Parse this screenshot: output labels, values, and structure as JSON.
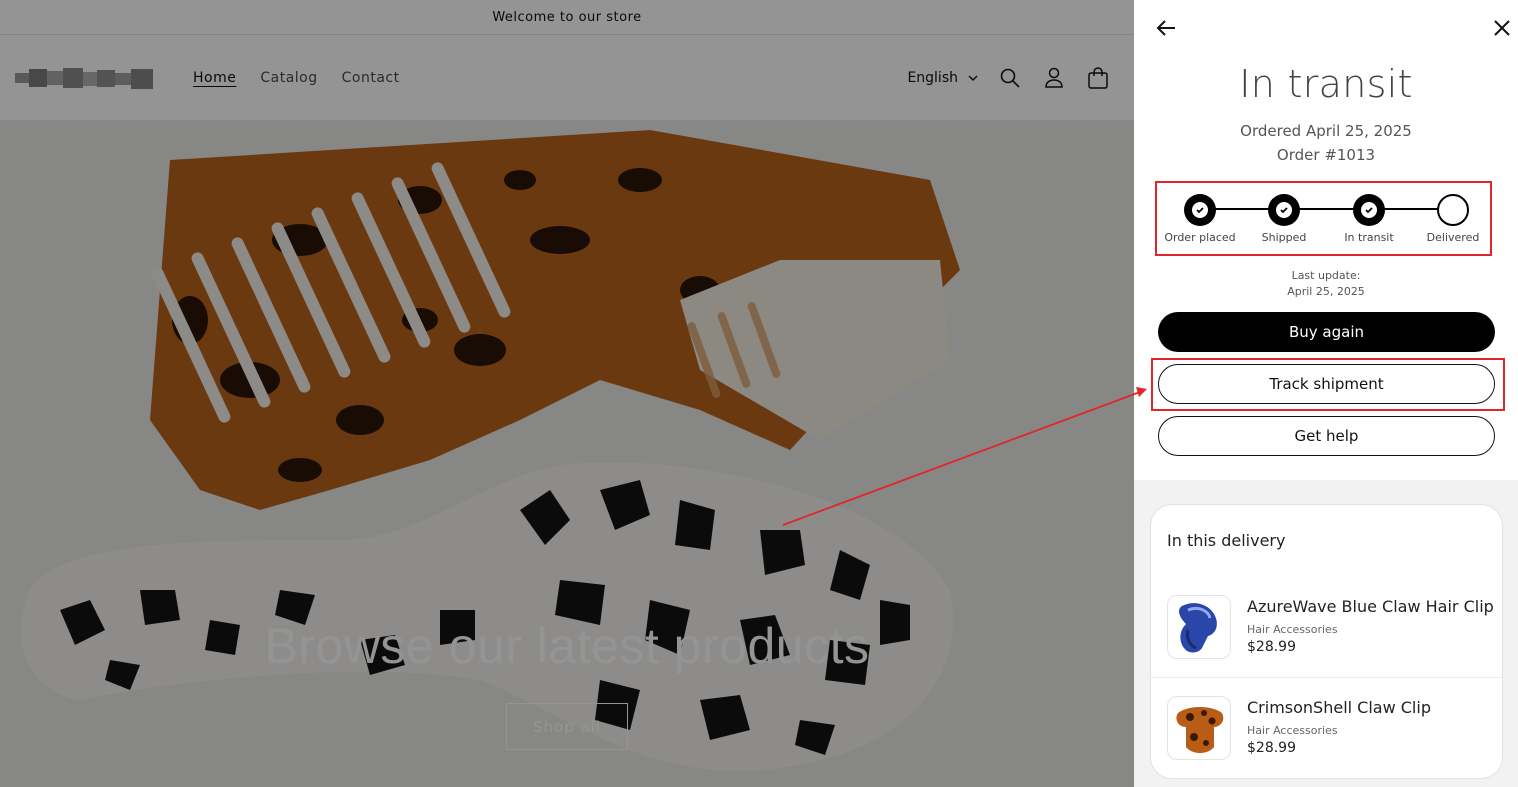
{
  "store": {
    "announcement": "Welcome to our store",
    "nav": [
      "Home",
      "Catalog",
      "Contact"
    ],
    "language": "English",
    "hero_title": "Browse our latest products",
    "hero_button": "Shop all"
  },
  "drawer": {
    "status": "In transit",
    "ordered": "Ordered April 25, 2025",
    "order_number": "Order #1013",
    "steps": [
      {
        "label": "Order placed",
        "done": true
      },
      {
        "label": "Shipped",
        "done": true
      },
      {
        "label": "In transit",
        "done": true
      },
      {
        "label": "Delivered",
        "done": false
      }
    ],
    "last_update_label": "Last update:",
    "last_update_date": "April 25, 2025",
    "buttons": {
      "buy_again": "Buy again",
      "track": "Track shipment",
      "help": "Get help"
    },
    "delivery": {
      "title": "In this delivery",
      "items": [
        {
          "name": "AzureWave Blue Claw Hair Clip",
          "category": "Hair Accessories",
          "price": "$28.99"
        },
        {
          "name": "CrimsonShell Claw Clip",
          "category": "Hair Accessories",
          "price": "$28.99"
        }
      ]
    }
  },
  "colors": {
    "highlight": "#e0262b",
    "primary_button": "#000000"
  },
  "icons": [
    "search-icon",
    "account-icon",
    "cart-icon",
    "chevron-down-icon",
    "back-arrow-icon",
    "close-icon",
    "check-icon"
  ]
}
